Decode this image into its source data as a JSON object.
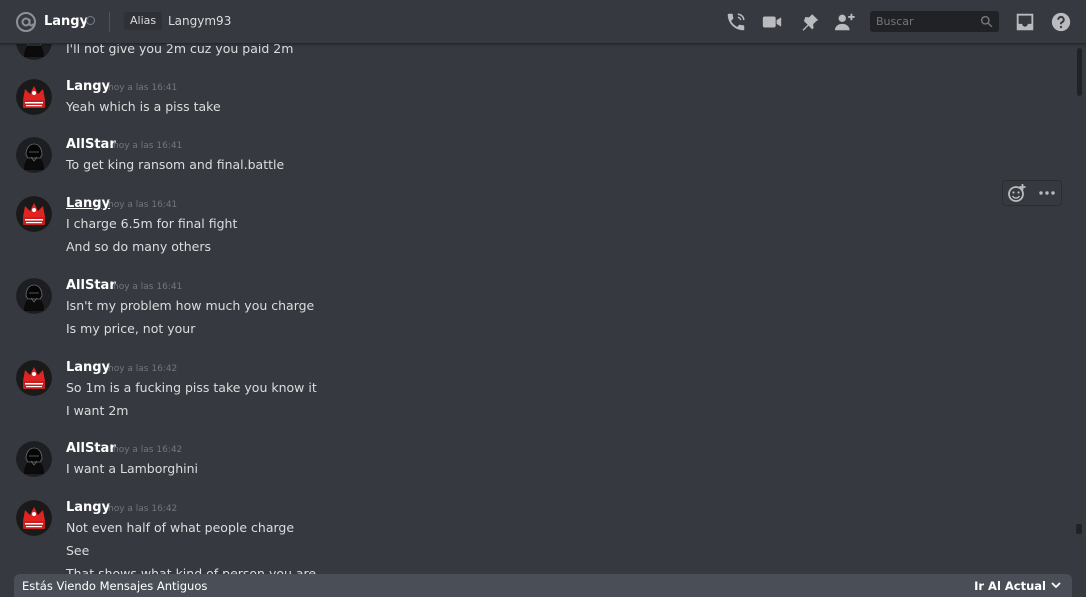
{
  "header": {
    "name": "Langy",
    "alias_label": "Alias",
    "alias_value": "Langym93",
    "search_placeholder": "Buscar",
    "icons": [
      "at-icon",
      "status-offline-icon",
      "phone-icon",
      "video-icon",
      "pin-icon",
      "add-friend-icon",
      "search-icon",
      "inbox-icon",
      "help-icon"
    ]
  },
  "messages": [
    {
      "kind": "continuation",
      "text": "I'll not give you 2m cuz you paid 2m"
    },
    {
      "author": "Langy",
      "timestamp": "hoy a las 16:41",
      "lines": [
        "Yeah which is a piss take"
      ]
    },
    {
      "author": "AllStar",
      "timestamp": "hoy a las 16:41",
      "lines": [
        "To get king ransom and final.battle"
      ]
    },
    {
      "author": "Langy",
      "timestamp": "hoy a las 16:41",
      "lines": [
        "I charge 6.5m for final fight",
        "And so do many others"
      ]
    },
    {
      "author": "AllStar",
      "timestamp": "hoy a las 16:41",
      "lines": [
        "Isn't my problem how much you charge",
        "Is my price, not your"
      ]
    },
    {
      "author": "Langy",
      "timestamp": "hoy a las 16:42",
      "lines": [
        "So 1m is a fucking piss take you know it",
        "I want 2m"
      ]
    },
    {
      "author": "AllStar",
      "timestamp": "hoy a las 16:42",
      "lines": [
        "I want a Lamborghini"
      ]
    },
    {
      "author": "Langy",
      "timestamp": "hoy a las 16:42",
      "lines": [
        "Not even half of what people charge",
        "See",
        "That shows what kind of person you are"
      ]
    }
  ],
  "hover_tools": {
    "icons": [
      "add-reaction-icon",
      "more-options-icon"
    ]
  },
  "old_messages_bar": {
    "text": "Estás Viendo Mensajes Antiguos",
    "jump_label": "Ir Al Actual",
    "jump_icon": "chevron-down-icon"
  },
  "colors": {
    "background": "#36393f",
    "header_text": "#ffffff",
    "timestamp": "#72767d",
    "search_bg": "#202225",
    "bar_bg": "#4a4f57"
  }
}
